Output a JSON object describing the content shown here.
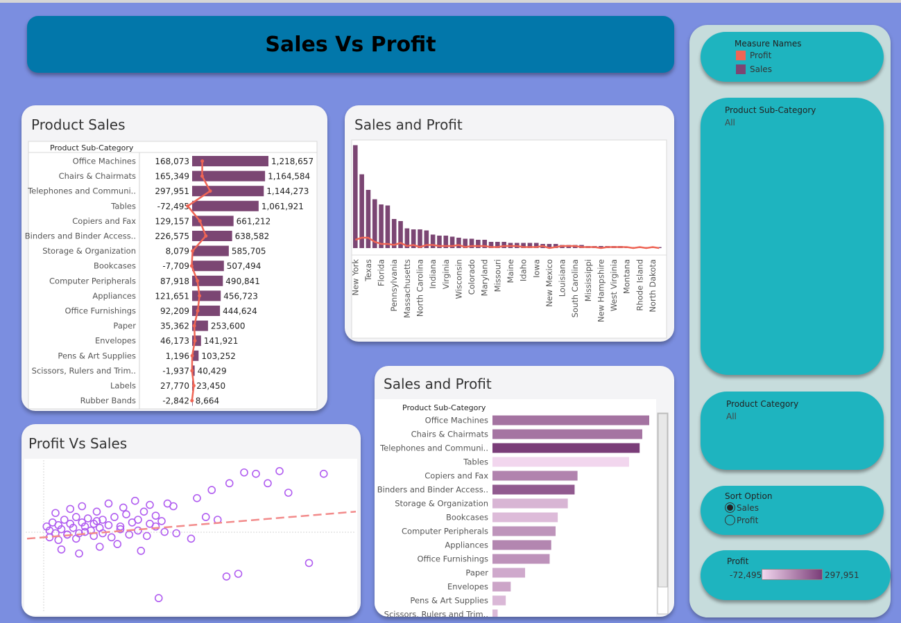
{
  "dashboard": {
    "title": "Sales Vs Profit"
  },
  "colors": {
    "background": "#7b8ee0",
    "banner": "#0277aa",
    "sales": "#7b4673",
    "profit": "#ef6555",
    "scatter": "#b05cf0",
    "filter_pill": "#1eb4bf",
    "side_panel": "#c6dcdc"
  },
  "sidebar": {
    "legend": {
      "title": "Measure Names",
      "items": [
        {
          "label": "Profit",
          "color": "#ef6555"
        },
        {
          "label": "Sales",
          "color": "#7b4673"
        }
      ]
    },
    "subcategory_filter": {
      "title": "Product Sub-Category",
      "value": "All"
    },
    "category_filter": {
      "title": "Product Category",
      "value": "All"
    },
    "sort_option": {
      "title": "Sort Option",
      "options": [
        "Sales",
        "Profit"
      ],
      "selected": "Sales"
    },
    "profit_scale": {
      "title": "Profit",
      "min_label": "-72,495",
      "max_label": "297,951"
    }
  },
  "product_sales": {
    "title": "Product Sales",
    "column_header": "Product Sub-Category",
    "chart_data": {
      "type": "bar",
      "categories": [
        "Office Machines",
        "Chairs & Chairmats",
        "Telephones and Communi..",
        "Tables",
        "Copiers and Fax",
        "Binders and Binder Access..",
        "Storage & Organization",
        "Bookcases",
        "Computer Peripherals",
        "Appliances",
        "Office Furnishings",
        "Paper",
        "Envelopes",
        "Pens & Art Supplies",
        "Scissors, Rulers and Trim..",
        "Labels",
        "Rubber Bands"
      ],
      "series": [
        {
          "name": "Sales",
          "values": [
            1218657,
            1164584,
            1144273,
            1061921,
            661212,
            638582,
            585705,
            507494,
            490841,
            456723,
            444624,
            253600,
            141921,
            103252,
            40429,
            23450,
            8664
          ],
          "labels": [
            "1,218,657",
            "1,164,584",
            "1,144,273",
            "1,061,921",
            "661,212",
            "638,582",
            "585,705",
            "507,494",
            "490,841",
            "456,723",
            "444,624",
            "253,600",
            "141,921",
            "103,252",
            "40,429",
            "23,450",
            "8,664"
          ]
        },
        {
          "name": "Profit",
          "values": [
            168073,
            165349,
            297951,
            -72495,
            129157,
            226575,
            8079,
            -7709,
            87918,
            121651,
            92209,
            35362,
            46173,
            1196,
            -1937,
            27770,
            -2842
          ],
          "labels": [
            "168,073",
            "165,349",
            "297,951",
            "-72,495",
            "129,157",
            "226,575",
            "8,079",
            "-7,709",
            "87,918",
            "121,651",
            "92,209",
            "35,362",
            "46,173",
            "1,196",
            "-1,937",
            "27,770",
            "-2,842"
          ]
        }
      ]
    }
  },
  "sales_profit_states": {
    "title": "Sales and Profit",
    "chart_data": {
      "type": "bar",
      "categories": [
        "New York",
        "Texas",
        "Florida",
        "Pennsylvania",
        "Massachusetts",
        "North Carolina",
        "Indiana",
        "Virginia",
        "Wisconsin",
        "Colorado",
        "Maryland",
        "Missouri",
        "Maine",
        "Idaho",
        "Iowa",
        "New Mexico",
        "Louisiana",
        "South Carolina",
        "Mississippi",
        "New Hampshire",
        "West Virginia",
        "Montana",
        "Rhode Island",
        "North Dakota"
      ],
      "series": [
        {
          "name": "Sales",
          "values": [
            0.99,
            0.71,
            0.56,
            0.47,
            0.42,
            0.41,
            0.28,
            0.26,
            0.19,
            0.18,
            0.18,
            0.17,
            0.13,
            0.12,
            0.12,
            0.11,
            0.1,
            0.09,
            0.09,
            0.08,
            0.08,
            0.06,
            0.06,
            0.06,
            0.05,
            0.05,
            0.05,
            0.05,
            0.05,
            0.04,
            0.04,
            0.04,
            0.03,
            0.03,
            0.03,
            0.03,
            0.02,
            0.02,
            0.02,
            0.02,
            0.02,
            0.02,
            0.01,
            0.01,
            0.01,
            0.01,
            0.01,
            0.01
          ]
        },
        {
          "name": "Profit",
          "values": [
            0.08,
            0.1,
            0.1,
            0.06,
            0.04,
            0.04,
            0.03,
            0.05,
            0.02,
            0.03,
            0.01,
            0.03,
            0.03,
            0.02,
            0.02,
            0.02,
            0.03,
            0.01,
            0.02,
            0.02,
            0.02,
            0.01,
            0.01,
            0.02,
            0.02,
            0.02,
            0.01,
            0.01,
            0.01,
            0.02,
            0.0,
            0.01,
            0.02,
            0.02,
            0.02,
            0.01,
            0.01,
            0.01,
            0.0,
            0.01,
            0.01,
            0.01,
            0.01,
            0.0,
            0.01,
            0.0,
            0.01,
            0.0
          ]
        }
      ]
    }
  },
  "profit_vs_sales": {
    "title": "Profit Vs Sales",
    "chart_data": {
      "type": "scatter",
      "x": [
        0.01,
        0.02,
        0.03,
        0.04,
        0.05,
        0.06,
        0.07,
        0.08,
        0.09,
        0.1,
        0.11,
        0.12,
        0.13,
        0.14,
        0.15,
        0.16,
        0.17,
        0.18,
        0.19,
        0.2,
        0.22,
        0.24,
        0.26,
        0.28,
        0.3,
        0.32,
        0.34,
        0.36,
        0.38,
        0.4,
        0.02,
        0.05,
        0.08,
        0.11,
        0.14,
        0.17,
        0.2,
        0.23,
        0.26,
        0.29,
        0.32,
        0.35,
        0.38,
        0.41,
        0.04,
        0.09,
        0.13,
        0.18,
        0.22,
        0.27,
        0.31,
        0.36,
        0.06,
        0.12,
        0.19,
        0.25,
        0.33,
        0.44,
        0.52,
        0.57,
        0.63,
        0.68,
        0.72,
        0.76,
        0.8,
        0.83,
        0.9,
        0.95,
        0.62,
        0.66,
        0.5,
        0.45,
        0.42,
        0.55,
        0.59,
        0.39
      ],
      "y": [
        0.55,
        0.52,
        0.58,
        0.5,
        0.56,
        0.53,
        0.6,
        0.49,
        0.57,
        0.54,
        0.62,
        0.5,
        0.58,
        0.55,
        0.61,
        0.52,
        0.57,
        0.59,
        0.54,
        0.6,
        0.56,
        0.62,
        0.55,
        0.64,
        0.58,
        0.6,
        0.66,
        0.57,
        0.63,
        0.59,
        0.47,
        0.45,
        0.49,
        0.46,
        0.51,
        0.48,
        0.5,
        0.47,
        0.53,
        0.49,
        0.52,
        0.48,
        0.55,
        0.51,
        0.65,
        0.68,
        0.7,
        0.66,
        0.72,
        0.69,
        0.74,
        0.71,
        0.38,
        0.35,
        0.4,
        0.42,
        0.37,
        0.7,
        0.76,
        0.82,
        0.87,
        0.95,
        0.94,
        0.87,
        0.96,
        0.8,
        0.28,
        0.94,
        0.18,
        0.2,
        0.46,
        0.5,
        0.72,
        0.62,
        0.6,
        0.02
      ],
      "trend": [
        0.46,
        0.66
      ]
    }
  },
  "sales_profit_products": {
    "title": "Sales and Profit",
    "column_header": "Product Sub-Category",
    "chart_data": {
      "type": "bar",
      "categories": [
        "Office Machines",
        "Chairs & Chairmats",
        "Telephones and Communi..",
        "Tables",
        "Copiers and Fax",
        "Binders and Binder Access..",
        "Storage & Organization",
        "Bookcases",
        "Computer Peripherals",
        "Appliances",
        "Office Furnishings",
        "Paper",
        "Envelopes",
        "Pens & Art Supplies",
        "Scissors, Rulers and Trim.."
      ],
      "series": [
        {
          "name": "Sales",
          "values": [
            1218657,
            1164584,
            1144273,
            1061921,
            661212,
            638582,
            585705,
            507494,
            490841,
            456723,
            444624,
            253600,
            141921,
            103252,
            40429
          ]
        },
        {
          "name": "Profit",
          "values": [
            168073,
            165349,
            297951,
            -72495,
            129157,
            226575,
            8079,
            -7709,
            87918,
            121651,
            92209,
            35362,
            46173,
            1196,
            -1937
          ]
        }
      ]
    }
  }
}
